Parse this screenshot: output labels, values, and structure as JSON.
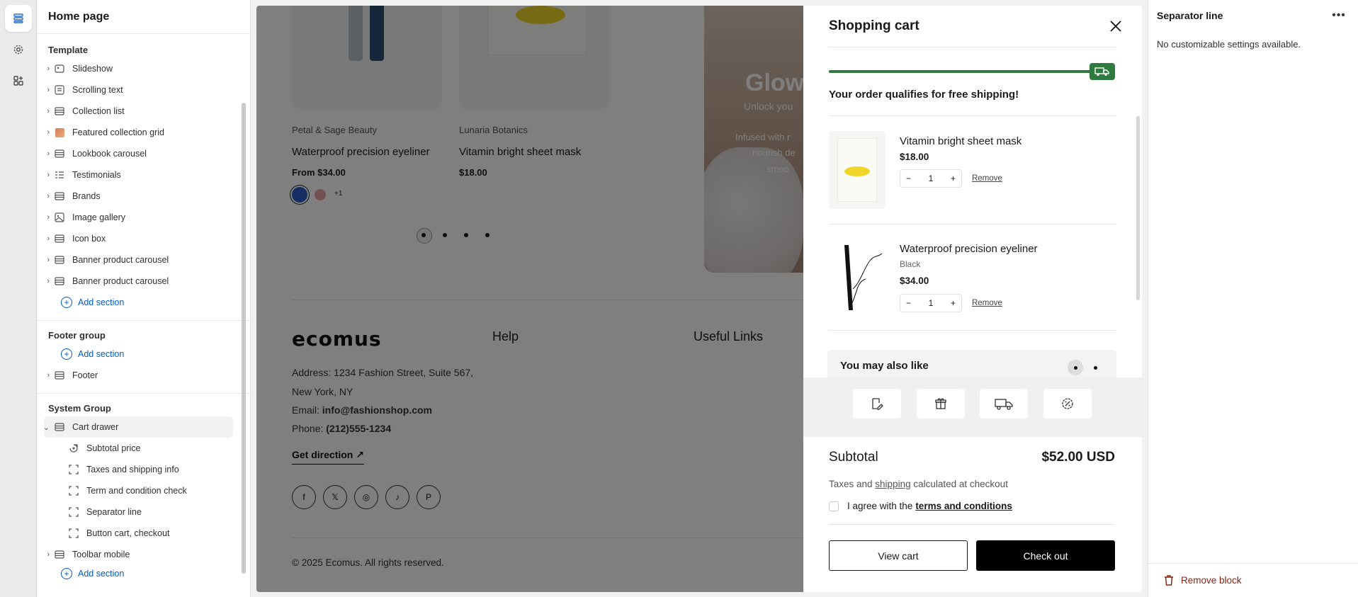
{
  "sidebar": {
    "title": "Home page",
    "template_title": "Template",
    "template_items": [
      {
        "label": "Slideshow"
      },
      {
        "label": "Scrolling text"
      },
      {
        "label": "Collection list"
      },
      {
        "label": "Featured collection grid"
      },
      {
        "label": "Lookbook carousel"
      },
      {
        "label": "Testimonials"
      },
      {
        "label": "Brands"
      },
      {
        "label": "Image gallery"
      },
      {
        "label": "Icon box"
      },
      {
        "label": "Banner product carousel"
      },
      {
        "label": "Banner product carousel"
      }
    ],
    "add_section": "Add section",
    "footer_group_title": "Footer group",
    "footer_item": "Footer",
    "system_group_title": "System Group",
    "cart_drawer": "Cart drawer",
    "cart_children": [
      {
        "label": "Subtotal price"
      },
      {
        "label": "Taxes and shipping info"
      },
      {
        "label": "Term and condition check"
      },
      {
        "label": "Separator line"
      },
      {
        "label": "Button cart, checkout"
      }
    ],
    "toolbar_mobile": "Toolbar mobile"
  },
  "preview": {
    "products": [
      {
        "brand": "Petal & Sage Beauty",
        "title": "Waterproof precision eyeliner",
        "price": "From $34.00",
        "more_swatches": "+1"
      },
      {
        "brand": "Lunaria Botanics",
        "title": "Vitamin bright sheet mask",
        "price": "$18.00"
      }
    ],
    "banner": {
      "heading": "Glow",
      "sub": "Unlock you",
      "body1": "Infused with r",
      "body2": "nourish de",
      "body3": "smoo"
    },
    "footer": {
      "logo": "ecomus",
      "help": "Help",
      "useful_links": "Useful Links",
      "address1": "Address: 1234 Fashion Street, Suite 567,",
      "address2": "New York, NY",
      "email_label": "Email: ",
      "email": "info@fashionshop.com",
      "phone_label": "Phone: ",
      "phone": "(212)555-1234",
      "direction": "Get direction",
      "copyright": "© 2025 Ecomus. All rights reserved."
    }
  },
  "cart": {
    "title": "Shopping cart",
    "shipping_msg": "Your order qualifies for free shipping!",
    "shipping_progress": 1.0,
    "items": [
      {
        "name": "Vitamin bright sheet mask",
        "variant": "",
        "price": "$18.00",
        "qty": "1",
        "remove": "Remove"
      },
      {
        "name": "Waterproof precision eyeliner",
        "variant": "Black",
        "price": "$34.00",
        "qty": "1",
        "remove": "Remove"
      }
    ],
    "also_like": "You may also like",
    "subtotal_label": "Subtotal",
    "subtotal_value": "$52.00 USD",
    "tax_pre": "Taxes and ",
    "tax_link": "shipping",
    "tax_post": " calculated at checkout",
    "agree_pre": "I agree with the",
    "agree_link": "terms and conditions",
    "view_cart": "View cart",
    "checkout": "Check out"
  },
  "settings": {
    "title": "Separator line",
    "empty": "No customizable settings available.",
    "remove_block": "Remove block"
  },
  "colors": {
    "accent": "#005bd3",
    "shipping": "#2f7a3e",
    "danger": "#8e1f0b"
  }
}
